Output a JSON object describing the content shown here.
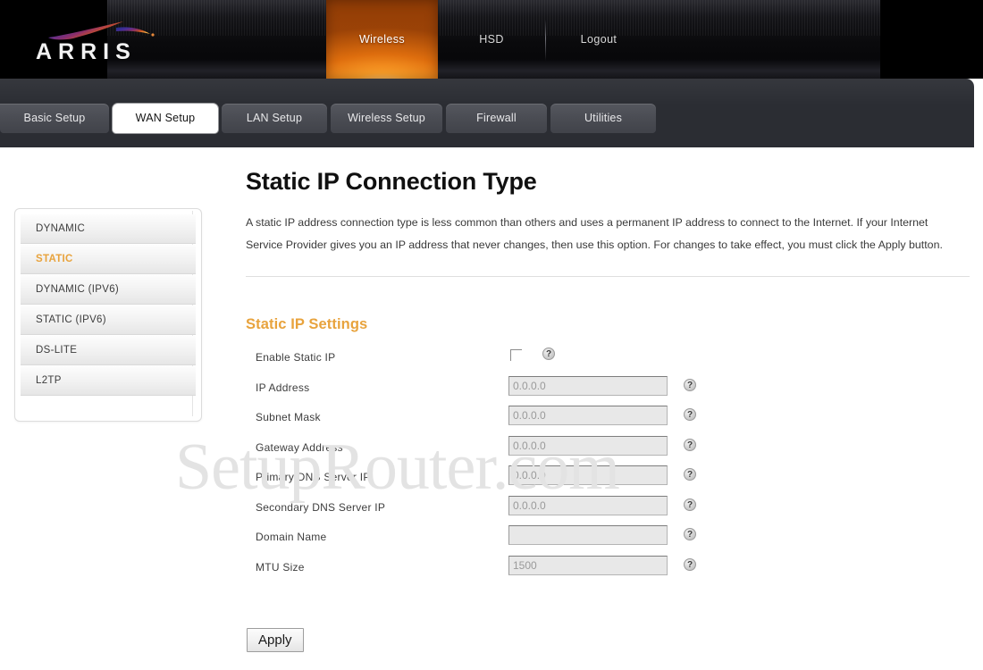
{
  "brand": {
    "logo_text": "ARRIS",
    "logo_icon": "arris-swoosh-logo"
  },
  "topnav": {
    "items": [
      {
        "label": "Wireless",
        "active": true
      },
      {
        "label": "HSD",
        "active": false
      },
      {
        "label": "Logout",
        "active": false
      }
    ]
  },
  "tabs": [
    {
      "label": "Basic Setup",
      "active": false
    },
    {
      "label": "WAN Setup",
      "active": true
    },
    {
      "label": "LAN Setup",
      "active": false
    },
    {
      "label": "Wireless Setup",
      "active": false
    },
    {
      "label": "Firewall",
      "active": false
    },
    {
      "label": "Utilities",
      "active": false
    }
  ],
  "sidebar": {
    "items": [
      {
        "label": "DYNAMIC",
        "active": false
      },
      {
        "label": "STATIC",
        "active": true
      },
      {
        "label": "DYNAMIC (IPV6)",
        "active": false
      },
      {
        "label": "STATIC (IPV6)",
        "active": false
      },
      {
        "label": "DS-LITE",
        "active": false
      },
      {
        "label": "L2TP",
        "active": false
      }
    ]
  },
  "main": {
    "title": "Static IP Connection Type",
    "description": "A static IP address connection type is less common than others and uses a permanent IP address to connect to the Internet. If your Internet Service Provider gives you an IP address that never changes, then use this option. For changes to take effect, you must click the Apply button.",
    "section_title": "Static IP Settings",
    "fields": [
      {
        "label": "Enable Static IP",
        "type": "checkbox",
        "checked": false,
        "value": "",
        "help": "?"
      },
      {
        "label": "IP Address",
        "type": "text",
        "value": "0.0.0.0",
        "help": "?"
      },
      {
        "label": "Subnet Mask",
        "type": "text",
        "value": "0.0.0.0",
        "help": "?"
      },
      {
        "label": "Gateway Address",
        "type": "text",
        "value": "0.0.0.0",
        "help": "?"
      },
      {
        "label": "Primary DNS Server IP",
        "type": "text",
        "value": "0.0.0.0",
        "help": "?"
      },
      {
        "label": "Secondary DNS Server IP",
        "type": "text",
        "value": "0.0.0.0",
        "help": "?"
      },
      {
        "label": "Domain Name",
        "type": "text",
        "value": "",
        "help": "?"
      },
      {
        "label": "MTU Size",
        "type": "text",
        "value": "1500",
        "help": "?"
      }
    ],
    "apply_label": "Apply"
  },
  "watermark": "SetupRouter.com",
  "colors": {
    "accent_orange": "#e8a33d",
    "header_black": "#000000",
    "tabstrip": "#2b2d33",
    "active_tab_bg": "#ffffff"
  }
}
